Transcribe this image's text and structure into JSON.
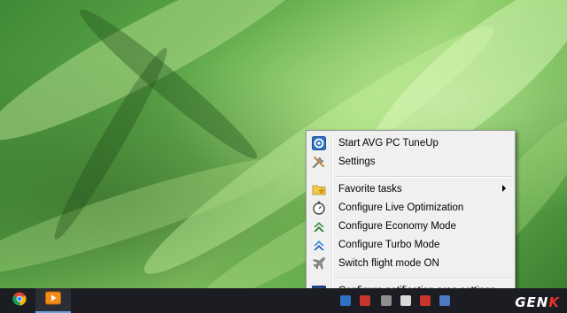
{
  "desktop": {
    "wallpaper": "green grass"
  },
  "context_menu": {
    "items": [
      {
        "label": "Start AVG PC TuneUp",
        "icon": "avg-tuneup-icon"
      },
      {
        "label": "Settings",
        "icon": "tools-icon"
      },
      {
        "label": "Favorite tasks",
        "icon": "folder-star-icon",
        "submenu": true
      },
      {
        "label": "Configure Live Optimization",
        "icon": "stopwatch-icon"
      },
      {
        "label": "Configure Economy Mode",
        "icon": "economy-mode-icon"
      },
      {
        "label": "Configure Turbo Mode",
        "icon": "turbo-mode-icon"
      },
      {
        "label": "Switch flight mode ON",
        "icon": "airplane-icon"
      },
      {
        "label": "Configure notification area settings",
        "icon": "notification-settings-icon"
      }
    ]
  },
  "taskbar": {
    "apps": [
      {
        "name": "Chrome",
        "icon": "chrome-icon"
      },
      {
        "name": "Media Player",
        "icon": "media-player-icon"
      }
    ]
  },
  "watermark": {
    "text_main": "GEN",
    "text_accent": "K"
  },
  "colors": {
    "menu_bg": "#f0f0f0",
    "taskbar_bg": "#1b1d22",
    "accent_blue": "#2f6fc4",
    "watermark_red": "#e8322d"
  }
}
